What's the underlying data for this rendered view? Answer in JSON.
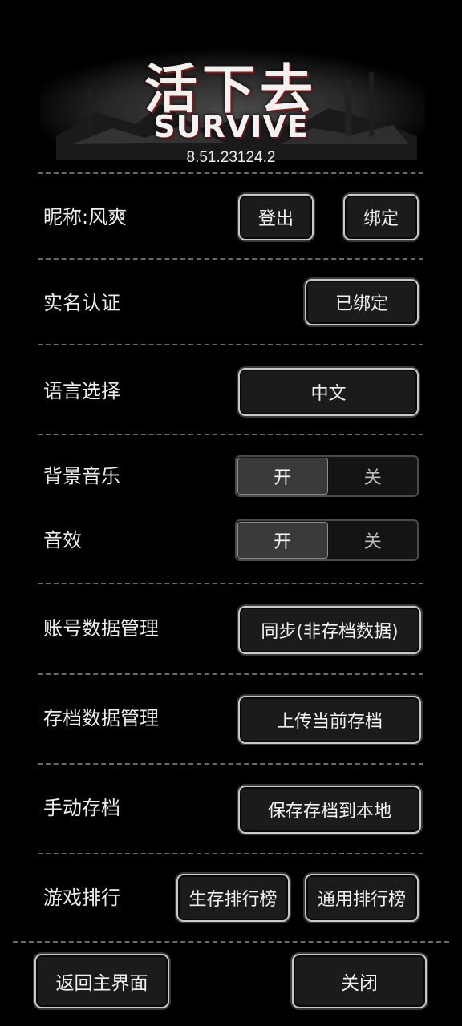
{
  "header": {
    "logo_cn": "活下去",
    "logo_en": "SURVIVE",
    "version": "8.51.23124.2"
  },
  "account": {
    "nickname": "昵称:风爽",
    "logout_label": "登出",
    "bind_label": "绑定"
  },
  "realname": {
    "label": "实名认证",
    "status_label": "已绑定"
  },
  "language": {
    "label": "语言选择",
    "value": "中文"
  },
  "bgm": {
    "label": "背景音乐",
    "on_label": "开",
    "off_label": "关",
    "state": "on"
  },
  "sfx": {
    "label": "音效",
    "on_label": "开",
    "off_label": "关",
    "state": "on"
  },
  "account_data": {
    "label": "账号数据管理",
    "sync_label": "同步(非存档数据)"
  },
  "save_data": {
    "label": "存档数据管理",
    "upload_label": "上传当前存档"
  },
  "manual_save": {
    "label": "手动存档",
    "save_local_label": "保存存档到本地"
  },
  "ranking": {
    "label": "游戏排行",
    "survival_label": "生存排行榜",
    "general_label": "通用排行榜"
  },
  "footer": {
    "back_label": "返回主界面",
    "close_label": "关闭"
  }
}
